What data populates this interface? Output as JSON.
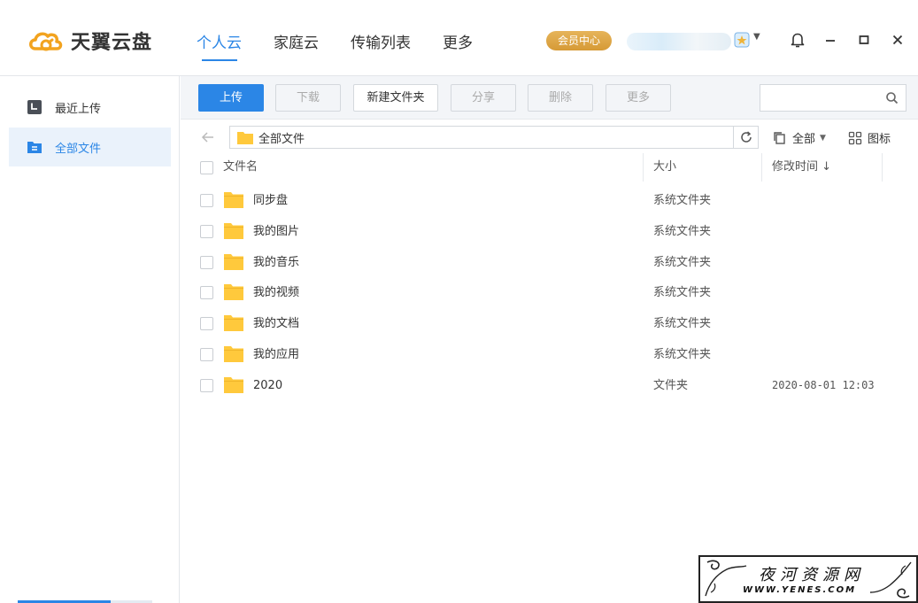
{
  "app": {
    "title": "天翼云盘"
  },
  "nav": {
    "items": [
      "个人云",
      "家庭云",
      "传输列表",
      "更多"
    ]
  },
  "vip_label": "会员中心",
  "sidebar": {
    "items": [
      {
        "label": "最近上传"
      },
      {
        "label": "全部文件"
      }
    ]
  },
  "toolbar": {
    "upload": "上传",
    "download": "下载",
    "new_folder": "新建文件夹",
    "share": "分享",
    "delete": "删除",
    "more": "更多",
    "search_placeholder": ""
  },
  "path": {
    "current": "全部文件"
  },
  "filter": {
    "label": "全部"
  },
  "view": {
    "label": "图标"
  },
  "table": {
    "headers": {
      "name": "文件名",
      "size": "大小",
      "modified": "修改时间 ↓"
    },
    "rows": [
      {
        "name": "同步盘",
        "size": "系统文件夹",
        "modified": ""
      },
      {
        "name": "我的图片",
        "size": "系统文件夹",
        "modified": ""
      },
      {
        "name": "我的音乐",
        "size": "系统文件夹",
        "modified": ""
      },
      {
        "name": "我的视频",
        "size": "系统文件夹",
        "modified": ""
      },
      {
        "name": "我的文档",
        "size": "系统文件夹",
        "modified": ""
      },
      {
        "name": "我的应用",
        "size": "系统文件夹",
        "modified": ""
      },
      {
        "name": "2020",
        "size": "文件夹",
        "modified": "2020-08-01 12:03"
      }
    ]
  },
  "watermark": {
    "cn": "夜河资源网",
    "en": "WWW.YENES.COM"
  },
  "colors": {
    "accent": "#2b86e6",
    "folder": "#ffc93c",
    "vip": "#dca443"
  }
}
